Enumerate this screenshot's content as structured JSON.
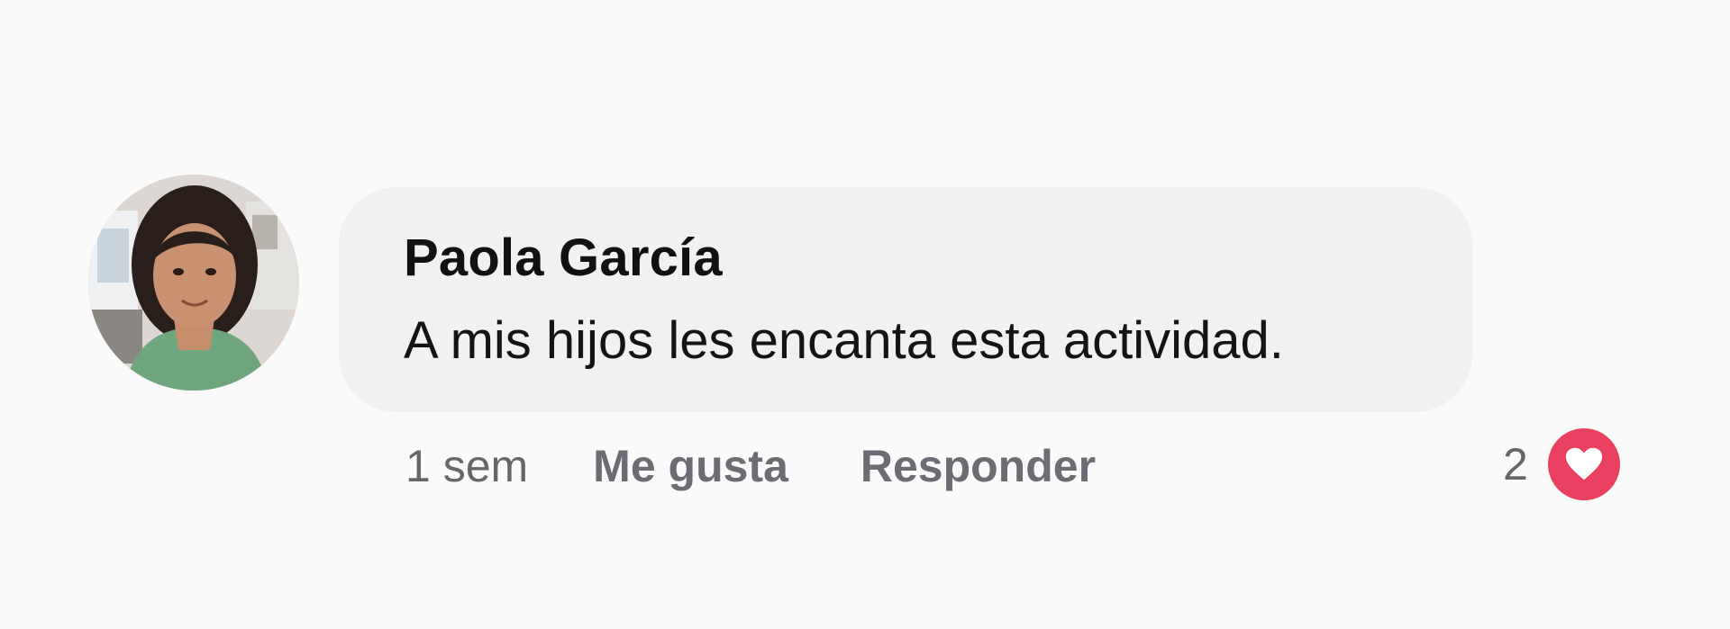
{
  "comment": {
    "author": "Paola García",
    "text": "A mis hijos les encanta esta actividad.",
    "time": "1 sem",
    "actions": {
      "like_label": "Me gusta",
      "reply_label": "Responder"
    },
    "reactions": {
      "count": "2",
      "icon": "heart-icon",
      "color": "#e8405e"
    }
  },
  "colors": {
    "background": "#fafafa",
    "bubble": "#f0f1f3",
    "secondary_text": "#65676b"
  }
}
